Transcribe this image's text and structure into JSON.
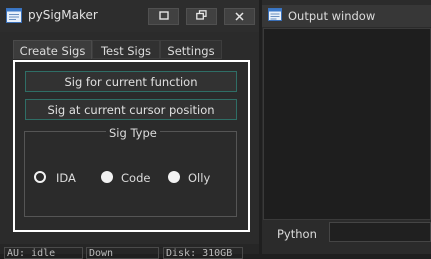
{
  "dialog": {
    "title": "pySigMaker",
    "tabs": [
      {
        "label": "Create Sigs",
        "active": true
      },
      {
        "label": "Test Sigs",
        "active": false
      },
      {
        "label": "Settings",
        "active": false
      }
    ],
    "buttons": {
      "sig_current_function": "Sig for current function",
      "sig_cursor_position": "Sig at current cursor position"
    },
    "sig_type": {
      "title": "Sig Type",
      "options": [
        {
          "label": "IDA",
          "selected": true
        },
        {
          "label": "Code",
          "selected": false
        },
        {
          "label": "Olly",
          "selected": false
        }
      ]
    }
  },
  "status_bar": {
    "fields": [
      "AU:  idle",
      "Down",
      "Disk: 310GB"
    ]
  },
  "output_window": {
    "title": "Output window",
    "input_label": "Python",
    "input_value": ""
  },
  "colors": {
    "background": "#2b2b2b",
    "button_border": "#2f6e66",
    "panel_highlight": "#ffffff"
  }
}
